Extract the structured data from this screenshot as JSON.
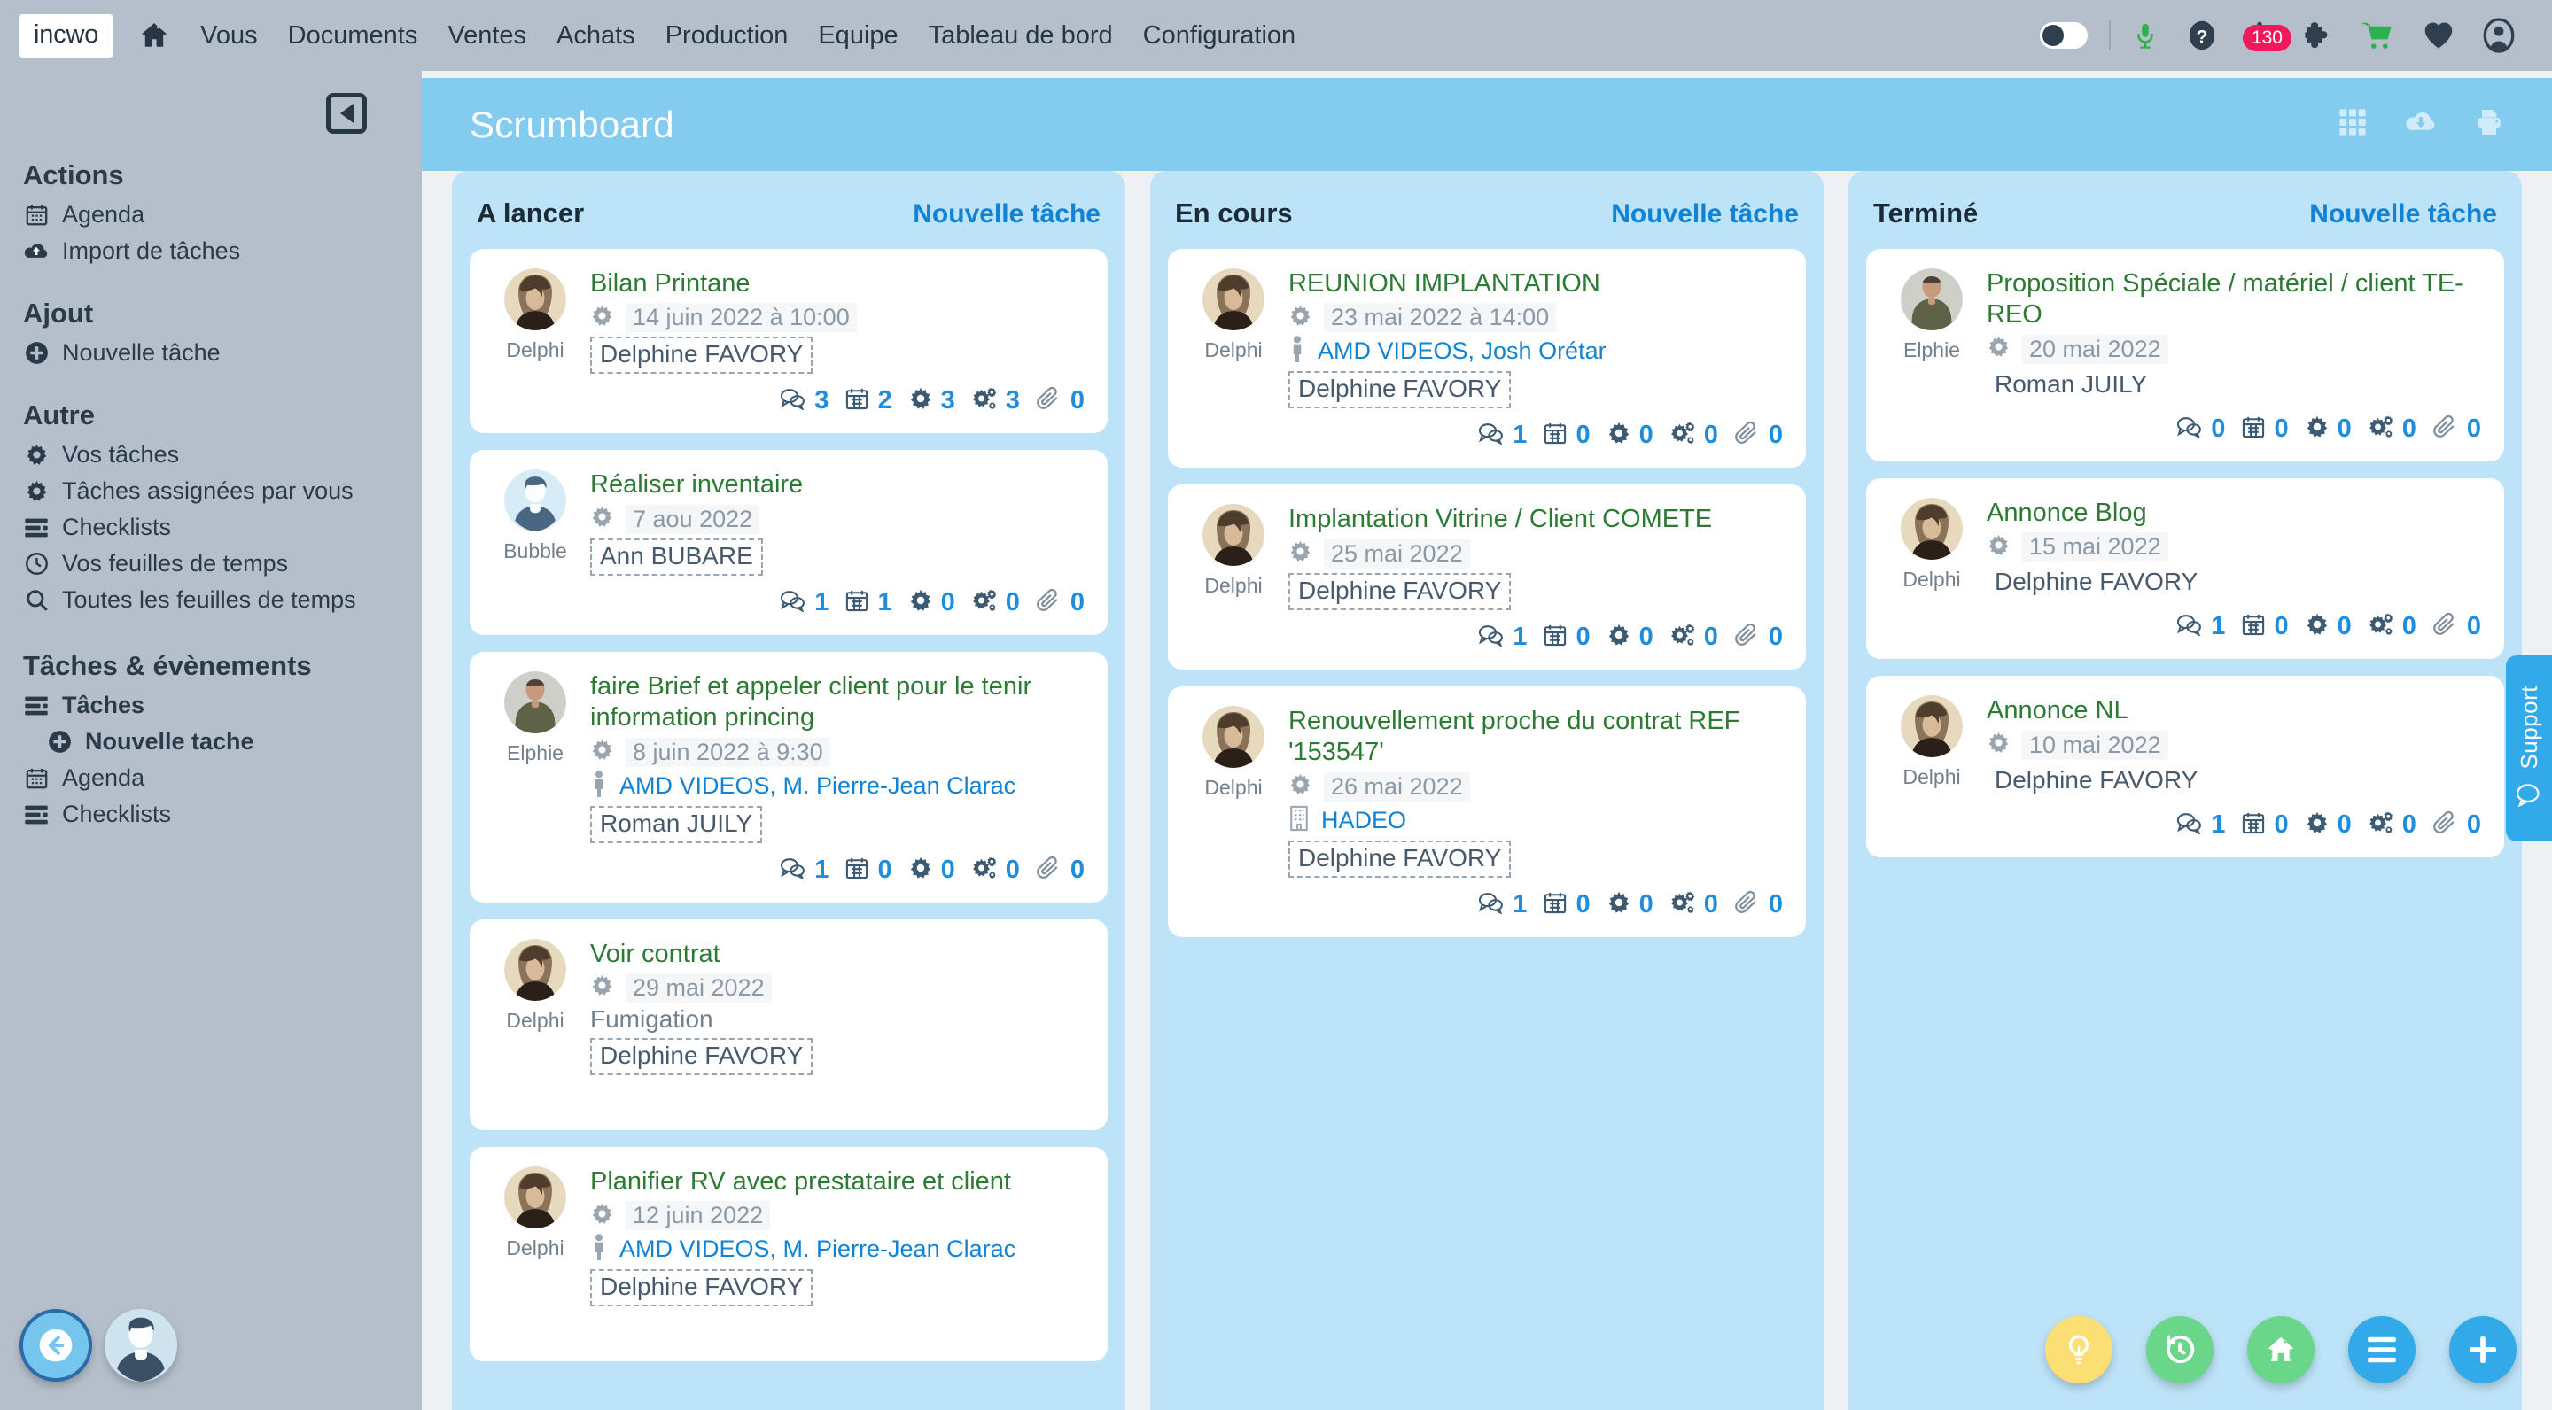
{
  "topnav": {
    "brand": "incwo",
    "home_icon": "home-icon",
    "links": [
      "Vous",
      "Documents",
      "Ventes",
      "Achats",
      "Production",
      "Equipe",
      "Tableau de bord",
      "Configuration"
    ],
    "right_icons": [
      {
        "name": "theme-toggle",
        "label": "toggle"
      },
      {
        "name": "microphone-icon",
        "label": "micro",
        "color": "#2bb24c"
      },
      {
        "name": "help-icon",
        "label": "aide"
      },
      {
        "name": "notifications-bell-icon",
        "label": "notifications",
        "badge": "130",
        "badge_color": "#f4175c"
      },
      {
        "name": "puzzle-icon",
        "label": "extensions"
      },
      {
        "name": "cart-icon",
        "label": "panier",
        "color": "#2bb24c"
      },
      {
        "name": "heart-icon",
        "label": "favoris"
      },
      {
        "name": "account-icon",
        "label": "compte"
      }
    ]
  },
  "sidebar": {
    "collapse_label": "Réduire le menu",
    "sections": [
      {
        "heading": "Actions",
        "items": [
          {
            "icon": "calendar-icon",
            "label": "Agenda",
            "bold": false,
            "indent": false
          },
          {
            "icon": "cloud-upload-icon",
            "label": "Import de tâches",
            "bold": false,
            "indent": false
          }
        ]
      },
      {
        "heading": "Ajout",
        "items": [
          {
            "icon": "plus-circle-icon",
            "label": "Nouvelle tâche",
            "bold": false,
            "indent": false
          }
        ]
      },
      {
        "heading": "Autre",
        "items": [
          {
            "icon": "gear-icon",
            "label": "Vos tâches",
            "bold": false,
            "indent": false
          },
          {
            "icon": "gear-icon",
            "label": "Tâches assignées par vous",
            "bold": false,
            "indent": false
          },
          {
            "icon": "list-icon",
            "label": "Checklists",
            "bold": false,
            "indent": false
          },
          {
            "icon": "clock-icon",
            "label": "Vos feuilles de temps",
            "bold": false,
            "indent": false
          },
          {
            "icon": "search-icon",
            "label": "Toutes les feuilles de temps",
            "bold": false,
            "indent": false
          }
        ]
      },
      {
        "heading": "Tâches & évènements",
        "items": [
          {
            "icon": "list-icon",
            "label": "Tâches",
            "bold": true,
            "indent": false
          },
          {
            "icon": "plus-circle-icon",
            "label": "Nouvelle tache",
            "bold": true,
            "indent": true
          },
          {
            "icon": "calendar-icon",
            "label": "Agenda",
            "bold": false,
            "indent": false
          },
          {
            "icon": "list-icon",
            "label": "Checklists",
            "bold": false,
            "indent": false
          }
        ]
      }
    ]
  },
  "board": {
    "title": "Scrumboard",
    "header_icons": [
      {
        "name": "grid-view-icon",
        "label": "Vue grille"
      },
      {
        "name": "cloud-download-icon",
        "label": "Télécharger"
      },
      {
        "name": "print-icon",
        "label": "Imprimer"
      }
    ],
    "stat_icons": [
      "comment-icon",
      "calendar-icon",
      "gear-icon",
      "gears-icon",
      "paperclip-icon"
    ],
    "columns": [
      {
        "title": "A lancer",
        "new_task_label": "Nouvelle tâche",
        "cards": [
          {
            "avatar_name": "Delphi",
            "avatar_type": "photo-woman",
            "title": "Bilan Printane",
            "date": "14 juin 2022 à 10:00",
            "contact": null,
            "contact_icon": null,
            "subject": null,
            "assignee": "Delphine FAVORY",
            "assignee_dashed": true,
            "stats": [
              "3",
              "2",
              "3",
              "3",
              "0"
            ]
          },
          {
            "avatar_name": "Bubble",
            "avatar_type": "placeholder",
            "title": "Réaliser inventaire",
            "date": "7 aou 2022",
            "contact": null,
            "contact_icon": null,
            "subject": null,
            "assignee": "Ann BUBARE",
            "assignee_dashed": true,
            "stats": [
              "1",
              "1",
              "0",
              "0",
              "0"
            ]
          },
          {
            "avatar_name": "Elphie",
            "avatar_type": "photo-man",
            "title": "faire Brief et appeler client pour le tenir information princing",
            "date": "8 juin 2022 à 9:30",
            "contact": "AMD VIDEOS, M. Pierre-Jean Clarac",
            "contact_icon": "person-icon",
            "subject": null,
            "assignee": "Roman JUILY",
            "assignee_dashed": true,
            "stats": [
              "1",
              "0",
              "0",
              "0",
              "0"
            ]
          },
          {
            "avatar_name": "Delphi",
            "avatar_type": "photo-woman",
            "title": "Voir contrat",
            "date": "29 mai 2022",
            "contact": null,
            "contact_icon": null,
            "subject": "Fumigation",
            "assignee": "Delphine FAVORY",
            "assignee_dashed": true,
            "stats": null
          },
          {
            "avatar_name": "Delphi",
            "avatar_type": "photo-woman",
            "title": "Planifier RV avec prestataire et client",
            "date": "12 juin 2022",
            "contact": "AMD VIDEOS, M. Pierre-Jean Clarac",
            "contact_icon": "person-icon",
            "subject": null,
            "assignee": "Delphine FAVORY",
            "assignee_dashed": true,
            "stats": null
          }
        ]
      },
      {
        "title": "En cours",
        "new_task_label": "Nouvelle tâche",
        "cards": [
          {
            "avatar_name": "Delphi",
            "avatar_type": "photo-woman",
            "title": "REUNION IMPLANTATION",
            "date": "23 mai 2022 à 14:00",
            "contact": "AMD VIDEOS, Josh Orétar",
            "contact_icon": "person-icon",
            "subject": null,
            "assignee": "Delphine FAVORY",
            "assignee_dashed": true,
            "stats": [
              "1",
              "0",
              "0",
              "0",
              "0"
            ]
          },
          {
            "avatar_name": "Delphi",
            "avatar_type": "photo-woman",
            "title": "Implantation Vitrine / Client COMETE",
            "date": "25 mai 2022",
            "contact": null,
            "contact_icon": null,
            "subject": null,
            "assignee": "Delphine FAVORY",
            "assignee_dashed": true,
            "stats": [
              "1",
              "0",
              "0",
              "0",
              "0"
            ]
          },
          {
            "avatar_name": "Delphi",
            "avatar_type": "photo-woman",
            "title": "Renouvellement proche du contrat REF '153547'",
            "date": "26 mai 2022",
            "contact": "HADEO",
            "contact_icon": "building-icon",
            "subject": null,
            "assignee": "Delphine FAVORY",
            "assignee_dashed": true,
            "stats": [
              "1",
              "0",
              "0",
              "0",
              "0"
            ]
          }
        ]
      },
      {
        "title": "Terminé",
        "new_task_label": "Nouvelle tâche",
        "cards": [
          {
            "avatar_name": "Elphie",
            "avatar_type": "photo-man",
            "title": "Proposition Spéciale / matériel / client TE-REO",
            "date": "20 mai 2022",
            "contact": null,
            "contact_icon": null,
            "subject": null,
            "assignee": "Roman JUILY",
            "assignee_dashed": false,
            "stats": [
              "0",
              "0",
              "0",
              "0",
              "0"
            ]
          },
          {
            "avatar_name": "Delphi",
            "avatar_type": "photo-woman",
            "title": "Annonce Blog",
            "date": "15 mai 2022",
            "contact": null,
            "contact_icon": null,
            "subject": null,
            "assignee": "Delphine FAVORY",
            "assignee_dashed": false,
            "stats": [
              "1",
              "0",
              "0",
              "0",
              "0"
            ]
          },
          {
            "avatar_name": "Delphi",
            "avatar_type": "photo-woman",
            "title": "Annonce NL",
            "date": "10 mai 2022",
            "contact": null,
            "contact_icon": null,
            "subject": null,
            "assignee": "Delphine FAVORY",
            "assignee_dashed": false,
            "stats": [
              "1",
              "0",
              "0",
              "0",
              "0"
            ]
          }
        ]
      }
    ]
  },
  "floating": {
    "back_label": "Retour",
    "user_label": "Profil",
    "actions": [
      {
        "name": "lightbulb-fab",
        "color": "#fbdf72",
        "icon": "lightbulb-icon"
      },
      {
        "name": "history-fab",
        "color": "#69d68a",
        "icon": "history-icon"
      },
      {
        "name": "home-fab",
        "color": "#69d68a",
        "icon": "home-icon"
      },
      {
        "name": "menu-fab",
        "color": "#32a9e8",
        "icon": "hamburger-icon"
      },
      {
        "name": "add-fab",
        "color": "#32a9e8",
        "icon": "plus-icon"
      }
    ]
  },
  "support": {
    "label": "Support",
    "icon": "chat-bubble-icon"
  },
  "colors": {
    "topbar": "#b5bfcb",
    "board_header": "#84cbf0",
    "column": "#bde3f8",
    "accent_blue": "#1283d4",
    "title_green": "#2d7a34",
    "badge_red": "#f4175c",
    "fab_green": "#69d68a",
    "fab_yellow": "#fbdf72"
  }
}
